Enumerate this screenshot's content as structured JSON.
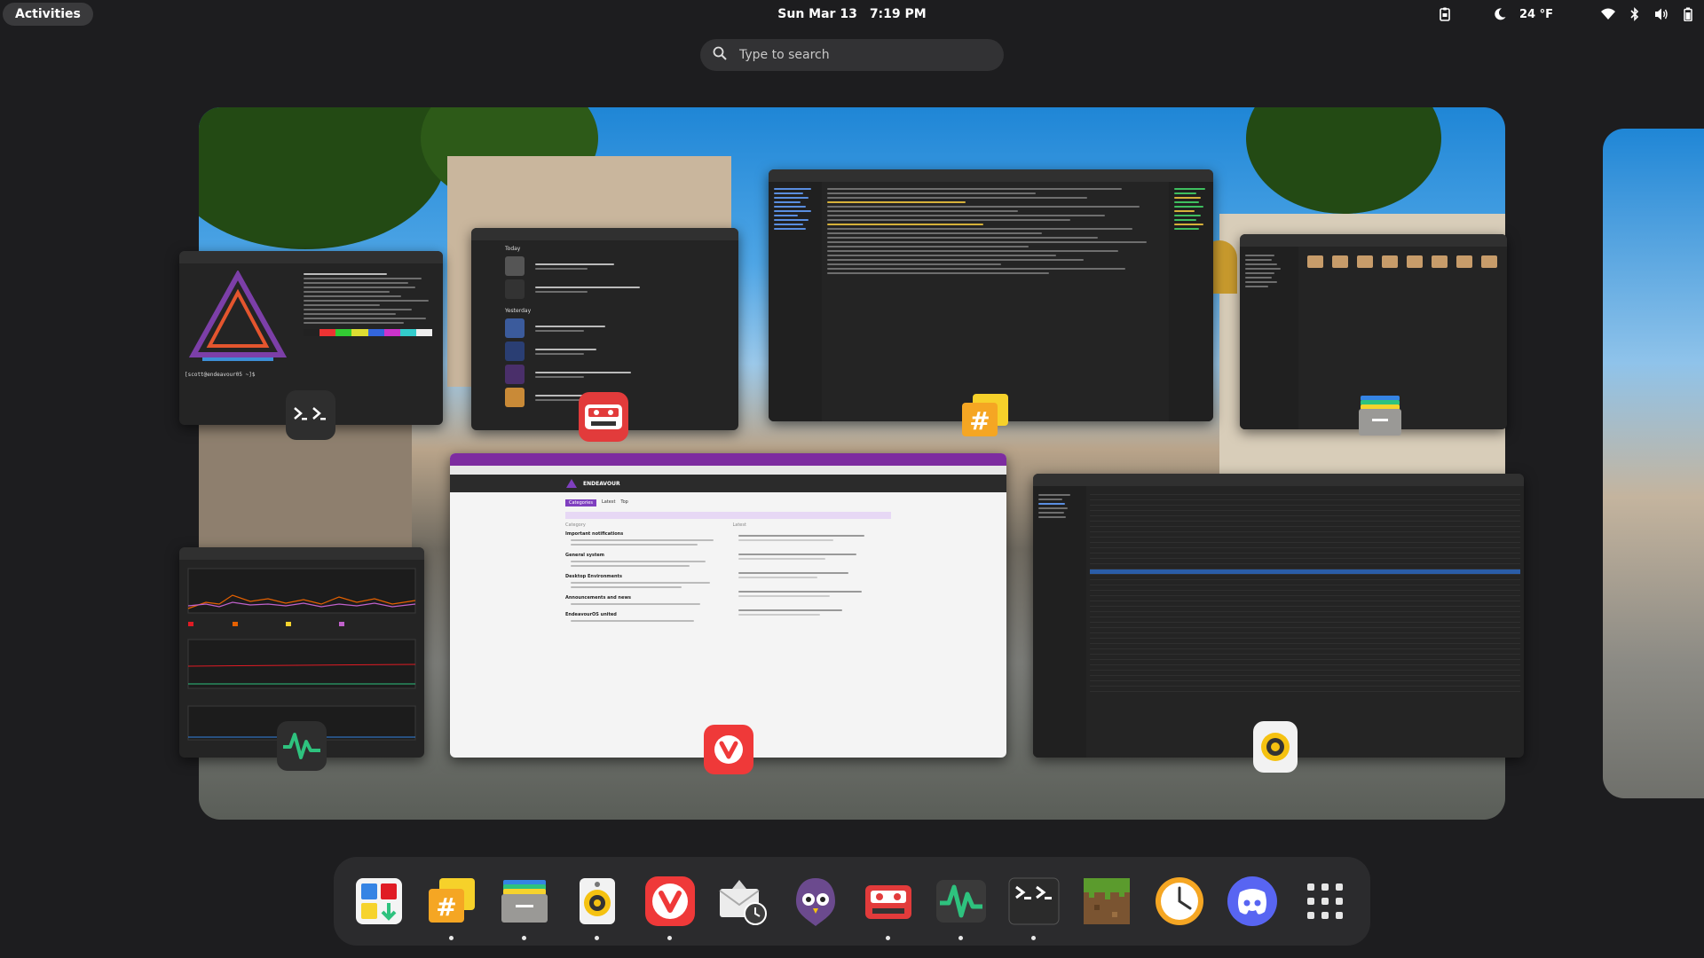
{
  "topbar": {
    "activities_label": "Activities",
    "date": "Sun Mar 13",
    "time": "7:19 PM",
    "weather_temp": "24 °F"
  },
  "search": {
    "placeholder": "Type to search"
  },
  "windows": {
    "terminal": {
      "prompt": "[scott@endeavour05 ~]$ "
    },
    "podcasts": {
      "section_today": "Today",
      "section_yesterday": "Yesterday"
    },
    "browser": {
      "site_title": "ENDEAVOUR",
      "categories_tab": "Categories",
      "latest_tab": "Latest",
      "top_tab": "Top",
      "col_category": "Category",
      "col_latest": "Latest",
      "cat_1": "Important notifications",
      "cat_2": "General system",
      "cat_3": "Desktop Environments",
      "cat_4": "Announcements and news",
      "cat_5": "EndeavourOS united"
    }
  },
  "dash": {
    "apps": [
      {
        "name": "software-store",
        "running": false
      },
      {
        "name": "hexchat",
        "running": true
      },
      {
        "name": "files",
        "running": true
      },
      {
        "name": "rhythmbox",
        "running": true
      },
      {
        "name": "vivaldi",
        "running": true
      },
      {
        "name": "mail-clock",
        "running": false
      },
      {
        "name": "tootle",
        "running": false
      },
      {
        "name": "podcasts",
        "running": true
      },
      {
        "name": "system-monitor",
        "running": true
      },
      {
        "name": "terminal",
        "running": true
      },
      {
        "name": "minecraft",
        "running": false
      },
      {
        "name": "clock",
        "running": false
      },
      {
        "name": "discord",
        "running": false
      }
    ]
  },
  "colors": {
    "panel_bg": "#1d1d1f",
    "dash_bg": "#2b2b2d",
    "vivaldi_red": "#ef3939",
    "discord_blurple": "#5865f2"
  }
}
